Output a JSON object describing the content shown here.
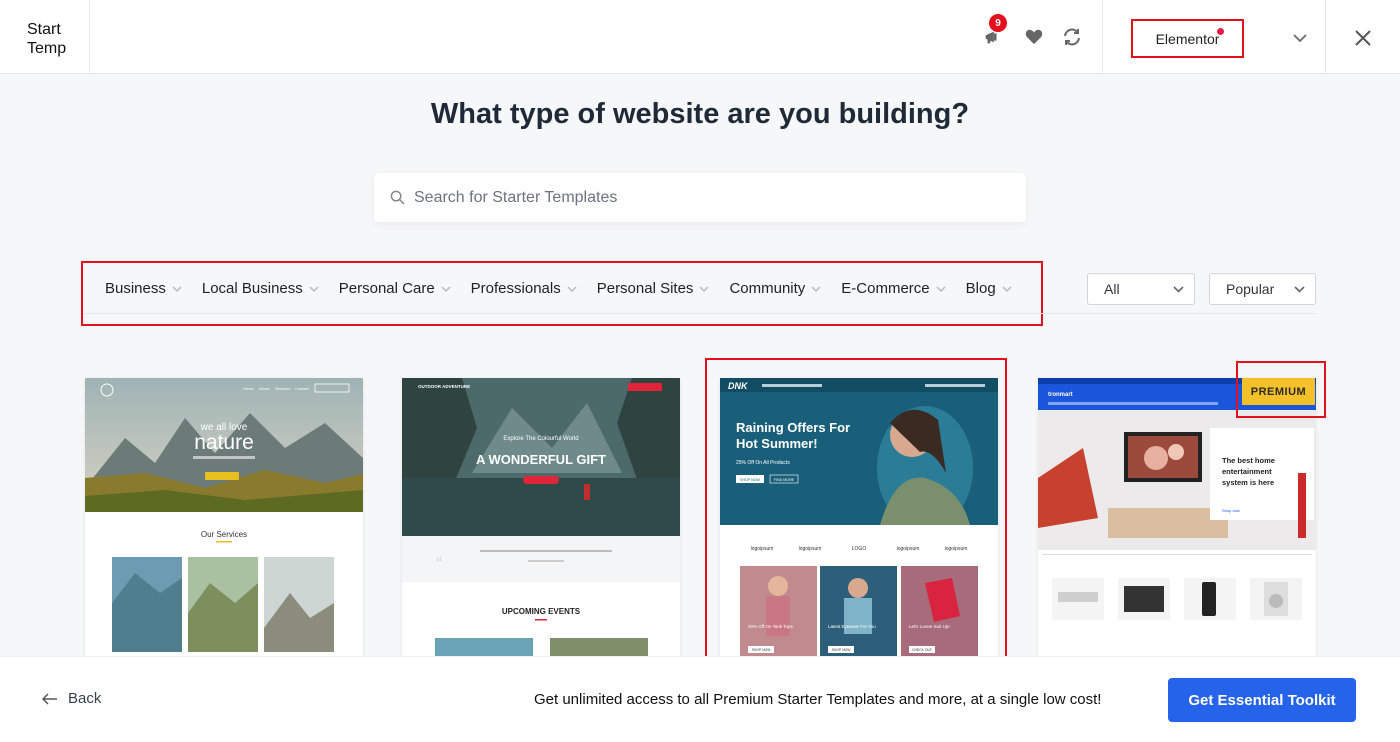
{
  "header": {
    "logo_line1": "Start",
    "logo_line2": "Temp",
    "notification_count": "9",
    "builder_label": "Elementor"
  },
  "heading": "What type of website are you building?",
  "search": {
    "placeholder": "Search for Starter Templates"
  },
  "categories": [
    "Business",
    "Local Business",
    "Personal Care",
    "Professionals",
    "Personal Sites",
    "Community",
    "E-Commerce",
    "Blog"
  ],
  "filters": {
    "type_selected": "All",
    "sort_selected": "Popular"
  },
  "templates": [
    {
      "nav": [
        "Home",
        "About",
        "Services",
        "Contact"
      ],
      "hero_small": "we all love",
      "hero_big": "nature",
      "section_title": "Our Services"
    },
    {
      "brand": "OUTDOOR ADVENTURE",
      "hero_small": "Explore The Colourful World",
      "hero_big": "A WONDERFUL GIFT",
      "events_title": "UPCOMING EVENTS"
    },
    {
      "brand": "DNK",
      "hero_title_1": "Raining Offers For",
      "hero_title_2": "Hot Summer!",
      "hero_sub": "25% Off On All Products",
      "btn1": "SHOP NOW",
      "btn2": "FIND MORE",
      "logos": [
        "logoipsum",
        "logoipsum",
        "LOGO",
        "logoipsum",
        "logoipsum"
      ],
      "products": [
        {
          "label": "20% Off On Tank Tops",
          "btn": "SHOP NOW"
        },
        {
          "label": "Latest Eyewear For You",
          "btn": "SHOP NOW"
        },
        {
          "label": "Let's Lorem Suit Up!",
          "btn": "CHECK OUT"
        }
      ]
    },
    {
      "badge": "PREMIUM",
      "brand": "tronmart",
      "hero_title": "The best home entertainment system is here",
      "hero_link": "Shop now"
    }
  ],
  "footer": {
    "back_label": "Back",
    "promo_text": "Get unlimited access to all Premium Starter Templates and more, at a single low cost!",
    "cta_label": "Get Essential Toolkit"
  },
  "colors": {
    "accent": "#2563eb",
    "highlight": "#e3101d",
    "premium": "#f5c12a"
  }
}
